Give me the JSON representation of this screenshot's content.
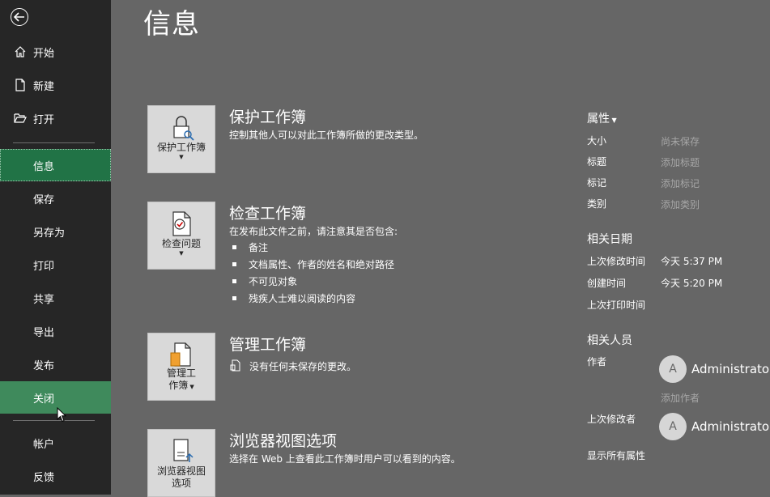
{
  "page_title": "信息",
  "sidebar": {
    "top_items": [
      {
        "label": "开始",
        "icon": "home-icon"
      },
      {
        "label": "新建",
        "icon": "new-document-icon"
      },
      {
        "label": "打开",
        "icon": "open-folder-icon"
      }
    ],
    "items": [
      "信息",
      "保存",
      "另存为",
      "打印",
      "共享",
      "导出",
      "发布",
      "关闭"
    ],
    "bottom_items": [
      "帐户",
      "反馈"
    ],
    "active": "信息",
    "hovered": "关闭"
  },
  "sections": {
    "protect": {
      "tile_label": "保护工作簿",
      "title": "保护工作簿",
      "desc": "控制其他人可以对此工作簿所做的更改类型。"
    },
    "inspect": {
      "tile_label": "检查问题",
      "title": "检查工作簿",
      "desc": "在发布此文件之前，请注意其是否包含:",
      "bullets": [
        "备注",
        "文档属性、作者的姓名和绝对路径",
        "不可见对象",
        "残疾人士难以阅读的内容"
      ]
    },
    "manage": {
      "tile_label_1": "管理工",
      "tile_label_2": "作簿",
      "title": "管理工作簿",
      "desc": "没有任何未保存的更改。"
    },
    "browser": {
      "tile_label_1": "浏览器视图",
      "tile_label_2": "选项",
      "title": "浏览器视图选项",
      "desc": "选择在 Web 上查看此工作簿时用户可以看到的内容。"
    }
  },
  "properties": {
    "header": "属性",
    "rows": [
      {
        "key": "大小",
        "value": "尚未保存"
      },
      {
        "key": "标题",
        "value": "添加标题"
      },
      {
        "key": "标记",
        "value": "添加标记"
      },
      {
        "key": "类别",
        "value": "添加类别"
      }
    ],
    "dates_header": "相关日期",
    "dates": [
      {
        "key": "上次修改时间",
        "value": "今天 5:37 PM"
      },
      {
        "key": "创建时间",
        "value": "今天 5:20 PM"
      },
      {
        "key": "上次打印时间",
        "value": ""
      }
    ],
    "people_header": "相关人员",
    "author_key": "作者",
    "author_initial": "A",
    "author_name": "Administrator",
    "add_author": "添加作者",
    "last_modified_by_key": "上次修改者",
    "modifier_initial": "A",
    "modifier_name": "Administrator",
    "show_all": "显示所有属性"
  }
}
